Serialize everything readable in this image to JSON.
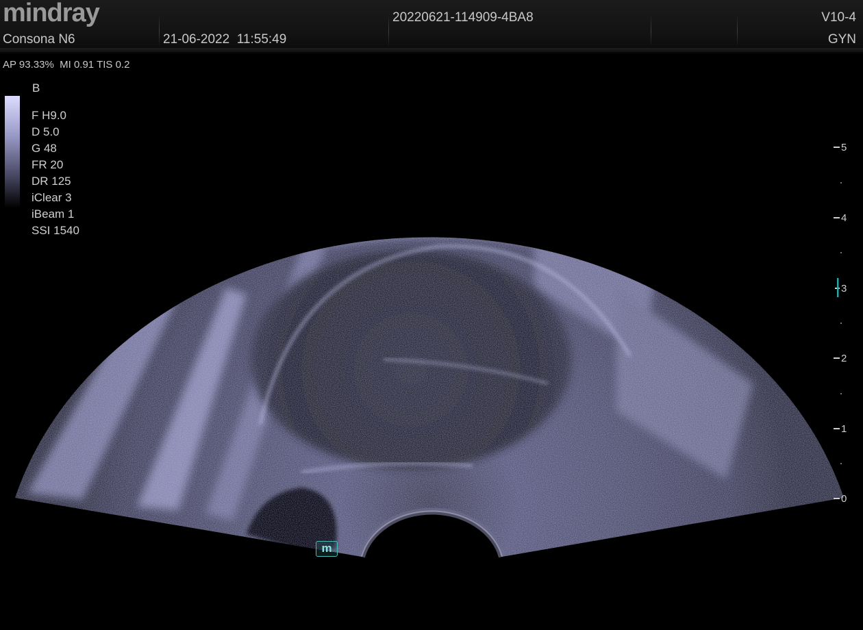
{
  "header": {
    "brand": "mindray",
    "model": "Consona N6",
    "date": "21-06-2022",
    "time": "11:55:49",
    "patient_id": "20220621-114909-4BA8",
    "probe": "V10-4",
    "exam": "GYN"
  },
  "acoustic_output": {
    "ap": "AP 93.33%",
    "mi": "MI 0.91",
    "tis": "TIS 0.2"
  },
  "imaging": {
    "mode": "B",
    "params": [
      "F H9.0",
      "D 5.0",
      "G 48",
      "FR 20",
      "DR 125",
      "iClear 3",
      "iBeam 1",
      "SSI 1540"
    ]
  },
  "depth_scale": {
    "labels": [
      "5",
      "4",
      "3",
      "2",
      "1",
      "0"
    ],
    "focus_depth": 3
  },
  "badge": {
    "label": "m"
  },
  "colors": {
    "background": "#000000",
    "tissue_tint": "#c8c8ff",
    "focus_marker": "#2aa5a5",
    "text": "#c8c8c8"
  }
}
